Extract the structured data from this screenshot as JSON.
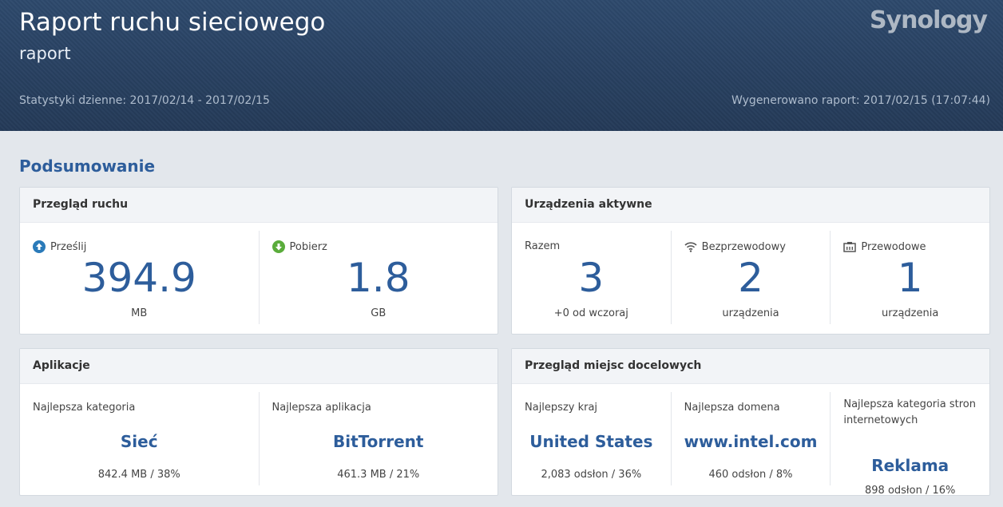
{
  "header": {
    "title": "Raport ruchu sieciowego",
    "subtitle": "raport",
    "stats": "Statystyki dzienne: 2017/02/14 - 2017/02/15",
    "generated": "Wygenerowano raport: 2017/02/15 (17:07:44)",
    "logo": "Synology"
  },
  "section_title": "Podsumowanie",
  "traffic": {
    "title": "Przegląd ruchu",
    "upload": {
      "label": "Prześlij",
      "value": "394.9",
      "unit": "MB"
    },
    "download": {
      "label": "Pobierz",
      "value": "1.8",
      "unit": "GB"
    }
  },
  "devices": {
    "title": "Urządzenia aktywne",
    "total": {
      "label": "Razem",
      "value": "3",
      "note": "+0 od wczoraj"
    },
    "wireless": {
      "label": "Bezprzewodowy",
      "value": "2",
      "note": "urządzenia"
    },
    "wired": {
      "label": "Przewodowe",
      "value": "1",
      "note": "urządzenia"
    }
  },
  "apps": {
    "title": "Aplikacje",
    "category": {
      "label": "Najlepsza kategoria",
      "value": "Sieć",
      "note": "842.4 MB / 38%"
    },
    "app": {
      "label": "Najlepsza aplikacja",
      "value": "BitTorrent",
      "note": "461.3 MB / 21%"
    }
  },
  "destinations": {
    "title": "Przegląd miejsc docelowych",
    "country": {
      "label": "Najlepszy kraj",
      "value": "United States",
      "note": "2,083 odsłon / 36%"
    },
    "domain": {
      "label": "Najlepsza domena",
      "value": "www.intel.com",
      "note": "460 odsłon / 8%"
    },
    "webcat": {
      "label": "Najlepsza kategoria stron internetowych",
      "value": "Reklama",
      "note": "898 odsłon / 16%"
    }
  },
  "colors": {
    "accent": "#2d5d9b",
    "upload_icon": "#2a7ab9",
    "download_icon": "#5aac3b",
    "header_bg": "#2b4363"
  },
  "icons": {
    "upload": "arrow-up-circle-icon",
    "download": "arrow-down-circle-icon",
    "wireless": "wifi-icon",
    "wired": "ethernet-icon"
  }
}
